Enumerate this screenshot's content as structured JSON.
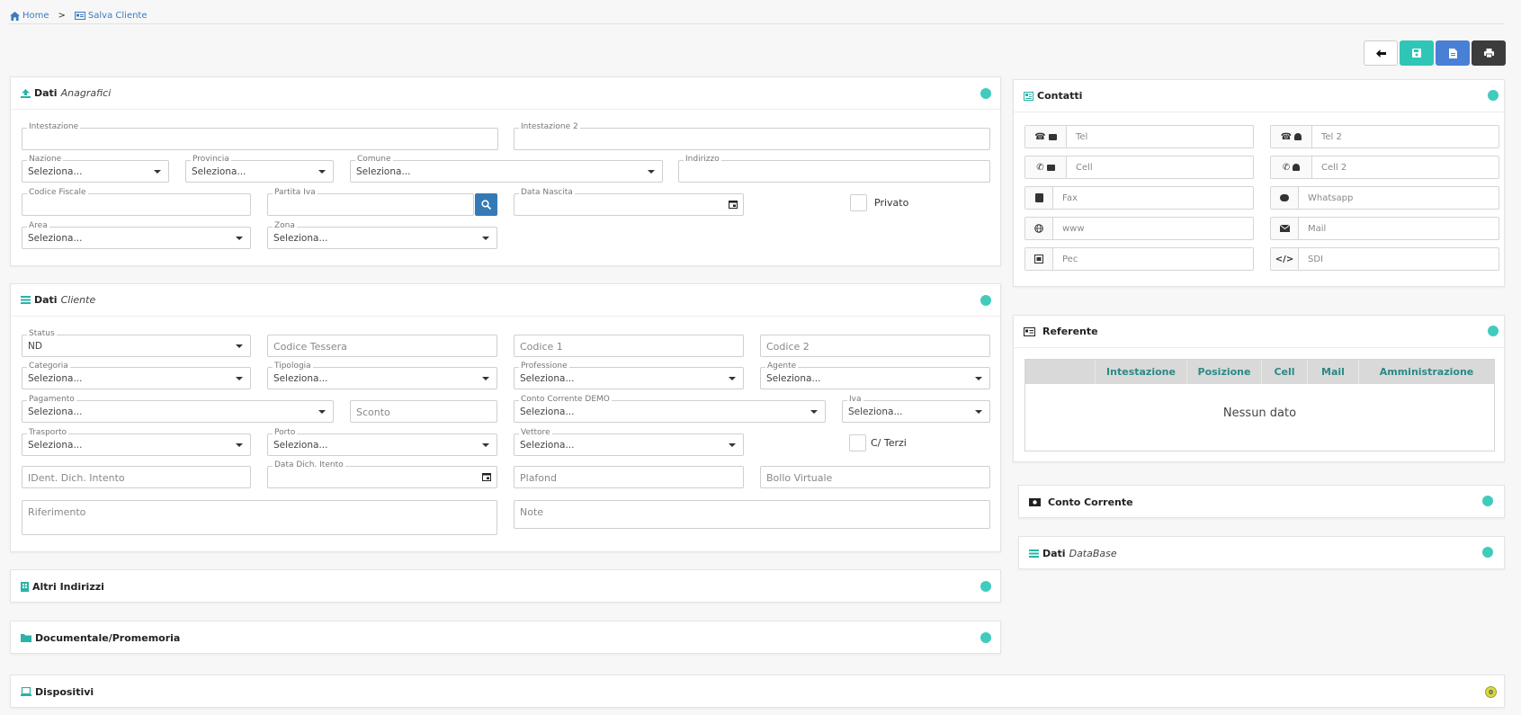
{
  "breadcrumb": {
    "home": "Home",
    "separator": ">",
    "current": "Salva Cliente"
  },
  "toolbar": {
    "back_icon": "arrow-left-icon",
    "save_icon": "save-icon",
    "document_icon": "file-icon",
    "print_icon": "print-icon"
  },
  "colors": {
    "accent": "#41cbbd",
    "link": "#3a7bbf",
    "save_btn": "#2fc6b7",
    "doc_btn": "#4a7fd6",
    "print_btn": "#3c3c3c",
    "header_text": "#2a8a86"
  },
  "anagrafici": {
    "title_bold": "Dati",
    "title_italic": "Anagrafici",
    "intestazione": "Intestazione",
    "intestazione2": "Intestazione 2",
    "nazione": {
      "label": "Nazione",
      "value": "Seleziona..."
    },
    "provincia": {
      "label": "Provincia",
      "value": "Seleziona..."
    },
    "comune": {
      "label": "Comune",
      "value": "Seleziona..."
    },
    "indirizzo": "Indirizzo",
    "codice_fiscale": "Codice Fiscale",
    "partita_iva": "Partita Iva",
    "data_nascita": "Data Nascita",
    "privato": "Privato",
    "area": {
      "label": "Area",
      "value": "Seleziona..."
    },
    "zona": {
      "label": "Zona",
      "value": "Seleziona..."
    }
  },
  "cliente": {
    "title_bold": "Dati",
    "title_italic": "Cliente",
    "status": {
      "label": "Status",
      "value": "ND"
    },
    "codice_tessera": "Codice Tessera",
    "codice1": "Codice 1",
    "codice2": "Codice 2",
    "categoria": {
      "label": "Categoria",
      "value": "Seleziona..."
    },
    "tipologia": {
      "label": "Tipologia",
      "value": "Seleziona..."
    },
    "professione": {
      "label": "Professione",
      "value": "Seleziona..."
    },
    "agente": {
      "label": "Agente",
      "value": "Seleziona..."
    },
    "pagamento": {
      "label": "Pagamento",
      "value": "Seleziona..."
    },
    "sconto": "Sconto",
    "conto_corrente": {
      "label": "Conto Corrente DEMO",
      "value": "Seleziona..."
    },
    "iva": {
      "label": "Iva",
      "value": "Seleziona..."
    },
    "trasporto": {
      "label": "Trasporto",
      "value": "Seleziona..."
    },
    "porto": {
      "label": "Porto",
      "value": "Seleziona..."
    },
    "vettore": {
      "label": "Vettore",
      "value": "Seleziona..."
    },
    "c_terzi": "C/ Terzi",
    "ident_dich": "IDent. Dich. Intento",
    "data_dich": "Data Dich. Itento",
    "plafond": "Plafond",
    "bollo": "Bollo Virtuale",
    "riferimento": "Riferimento",
    "note": "Note"
  },
  "altri_indirizzi": "Altri Indirizzi",
  "documentale": "Documentale/Promemoria",
  "dispositivi": {
    "title": "Dispositivi",
    "badge": "0"
  },
  "contatti": {
    "title": "Contatti",
    "tel": "Tel",
    "tel2": "Tel 2",
    "cell": "Cell",
    "cell2": "Cell 2",
    "fax": "Fax",
    "whatsapp": "Whatsapp",
    "www": "www",
    "mail": "Mail",
    "pec": "Pec",
    "sdi": "SDI"
  },
  "referente": {
    "title": "Referente",
    "columns": [
      "",
      "Intestazione",
      "Posizione",
      "Cell",
      "Mail",
      "Amministrazione"
    ],
    "empty": "Nessun dato"
  },
  "conto_corrente_panel": "Conto Corrente",
  "database": {
    "title_bold": "Dati",
    "title_italic": "DataBase"
  }
}
